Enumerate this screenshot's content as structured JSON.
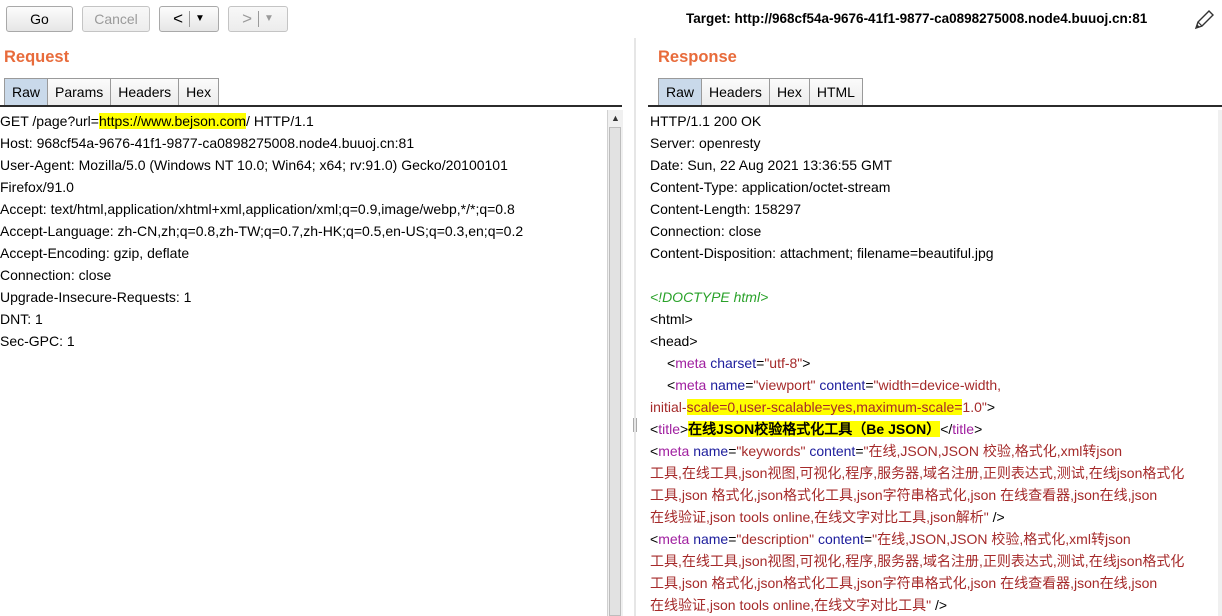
{
  "toolbar": {
    "go_label": "Go",
    "cancel_label": "Cancel",
    "back_glyph": "<",
    "forward_glyph": ">",
    "dropdown_glyph": "▼",
    "target_text": "Target: http://968cf54a-9676-41f1-9877-ca0898275008.node4.buuoj.cn:81",
    "edit_icon": "pencil-icon"
  },
  "request": {
    "title": "Request",
    "tabs": [
      "Raw",
      "Params",
      "Headers",
      "Hex"
    ],
    "active_tab": "Raw",
    "line1": {
      "a": "GET /page?url=",
      "hl": "https://www.bejson.com",
      "b": "/ HTTP/1.1"
    },
    "lines": [
      "Host: 968cf54a-9676-41f1-9877-ca0898275008.node4.buuoj.cn:81",
      "User-Agent: Mozilla/5.0 (Windows NT 10.0; Win64; x64; rv:91.0) Gecko/20100101",
      "Firefox/91.0",
      "Accept: text/html,application/xhtml+xml,application/xml;q=0.9,image/webp,*/*;q=0.8",
      "Accept-Language: zh-CN,zh;q=0.8,zh-TW;q=0.7,zh-HK;q=0.5,en-US;q=0.3,en;q=0.2",
      "Accept-Encoding: gzip, deflate",
      "Connection: close",
      "Upgrade-Insecure-Requests: 1",
      "DNT: 1",
      "Sec-GPC: 1"
    ]
  },
  "response": {
    "title": "Response",
    "tabs": [
      "Raw",
      "Headers",
      "Hex",
      "HTML"
    ],
    "active_tab": "Raw",
    "headers": [
      "HTTP/1.1 200 OK",
      "Server: openresty",
      "Date: Sun, 22 Aug 2021 13:36:55 GMT",
      "Content-Type: application/octet-stream",
      "Content-Length: 158297",
      "Connection: close",
      "Content-Disposition: attachment; filename=beautiful.jpg"
    ],
    "body": {
      "doctype": "<!DOCTYPE html>",
      "html_open": "<html>",
      "head_open": "<head>",
      "meta_charset": {
        "lt": "<",
        "tag": "meta",
        "attr": " charset",
        "eq": "=",
        "val": "\"utf-8\"",
        "gt": ">"
      },
      "meta_viewport_1": {
        "lt": "<",
        "tag": "meta",
        "attr1": " name",
        "eq1": "=",
        "val1": "\"viewport\"",
        "attr2": " content",
        "eq2": "=",
        "val2": "\"width=device-width,"
      },
      "meta_viewport_2": {
        "pre": "initial-",
        "hl": "scale=0,user-scalable=yes,maximum-scale=",
        "post": "1.0\"",
        "gt": ">"
      },
      "title_line": {
        "lt": "<",
        "tag": "title",
        "gt": ">",
        "hl": "在线JSON校验格式化工具（Be JSON）",
        "close_lt": "</",
        "close_tag": "title",
        "close_gt": ">"
      },
      "meta_keywords_1": {
        "lt": "<",
        "tag": "meta",
        "attr1": " name",
        "eq1": "=",
        "val1": "\"keywords\"",
        "attr2": " content",
        "eq2": "=",
        "val2": "\"在线,JSON,JSON 校验,格式化,xml转json"
      },
      "meta_keywords_2": "工具,在线工具,json视图,可视化,程序,服务器,域名注册,正则表达式,测试,在线json格式化",
      "meta_keywords_3": "工具,json 格式化,json格式化工具,json字符串格式化,json 在线查看器,json在线,json",
      "meta_keywords_4": {
        "val": "在线验证,json tools online,在线文字对比工具,json解析\"",
        "end": " />"
      },
      "meta_desc_1": {
        "lt": "<",
        "tag": "meta",
        "attr1": " name",
        "eq1": "=",
        "val1": "\"description\"",
        "attr2": " content",
        "eq2": "=",
        "val2": "\"在线,JSON,JSON 校验,格式化,xml转json"
      },
      "meta_desc_2": "工具,在线工具,json视图,可视化,程序,服务器,域名注册,正则表达式,测试,在线json格式化",
      "meta_desc_3": "工具,json 格式化,json格式化工具,json字符串格式化,json 在线查看器,json在线,json",
      "meta_desc_4": {
        "val": "在线验证,json tools online,在线文字对比工具\"",
        "end": " />"
      }
    }
  }
}
